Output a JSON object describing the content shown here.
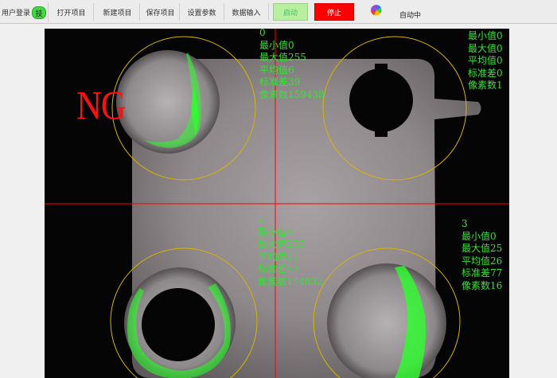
{
  "toolbar": {
    "user_login": "用户登录",
    "role_badge": "技",
    "open_project": "打开项目",
    "new_project": "新建项目",
    "save_project": "保存项目",
    "set_params": "设置参数",
    "data_input": "数据输入",
    "start": "启动",
    "stop": "停止",
    "status_icon": "pinwheel-icon",
    "status": "自动中"
  },
  "result": {
    "verdict": "NG",
    "verdict_color": "#ff1010"
  },
  "regions": [
    {
      "id": "0",
      "min_label": "最小值0",
      "max_label": "最大值255",
      "avg_label": "平均值6",
      "std_label": "标准差39",
      "pixels_label": "像素数159438"
    },
    {
      "id": "",
      "min_label": "最小值0",
      "max_label": "最大值0",
      "avg_label": "平均值0",
      "std_label": "标准差0",
      "pixels_label": "像素数1"
    },
    {
      "id": "2",
      "min_label": "最小值0",
      "max_label": "最大值255",
      "avg_label": "平均值11",
      "std_label": "标准差53",
      "pixels_label": "像素数174832"
    },
    {
      "id": "3",
      "min_label": "最小值0",
      "max_label": "最大值25",
      "avg_label": "平均值26",
      "std_label": "标准差77",
      "pixels_label": "像素数16"
    }
  ],
  "colors": {
    "stat_text": "#35e235",
    "roi_circle": "#d8b400",
    "crosshair": "#ff0000",
    "defect": "#2cff2c",
    "stop_button": "#ff0000",
    "start_button": "#b8f0a0"
  }
}
